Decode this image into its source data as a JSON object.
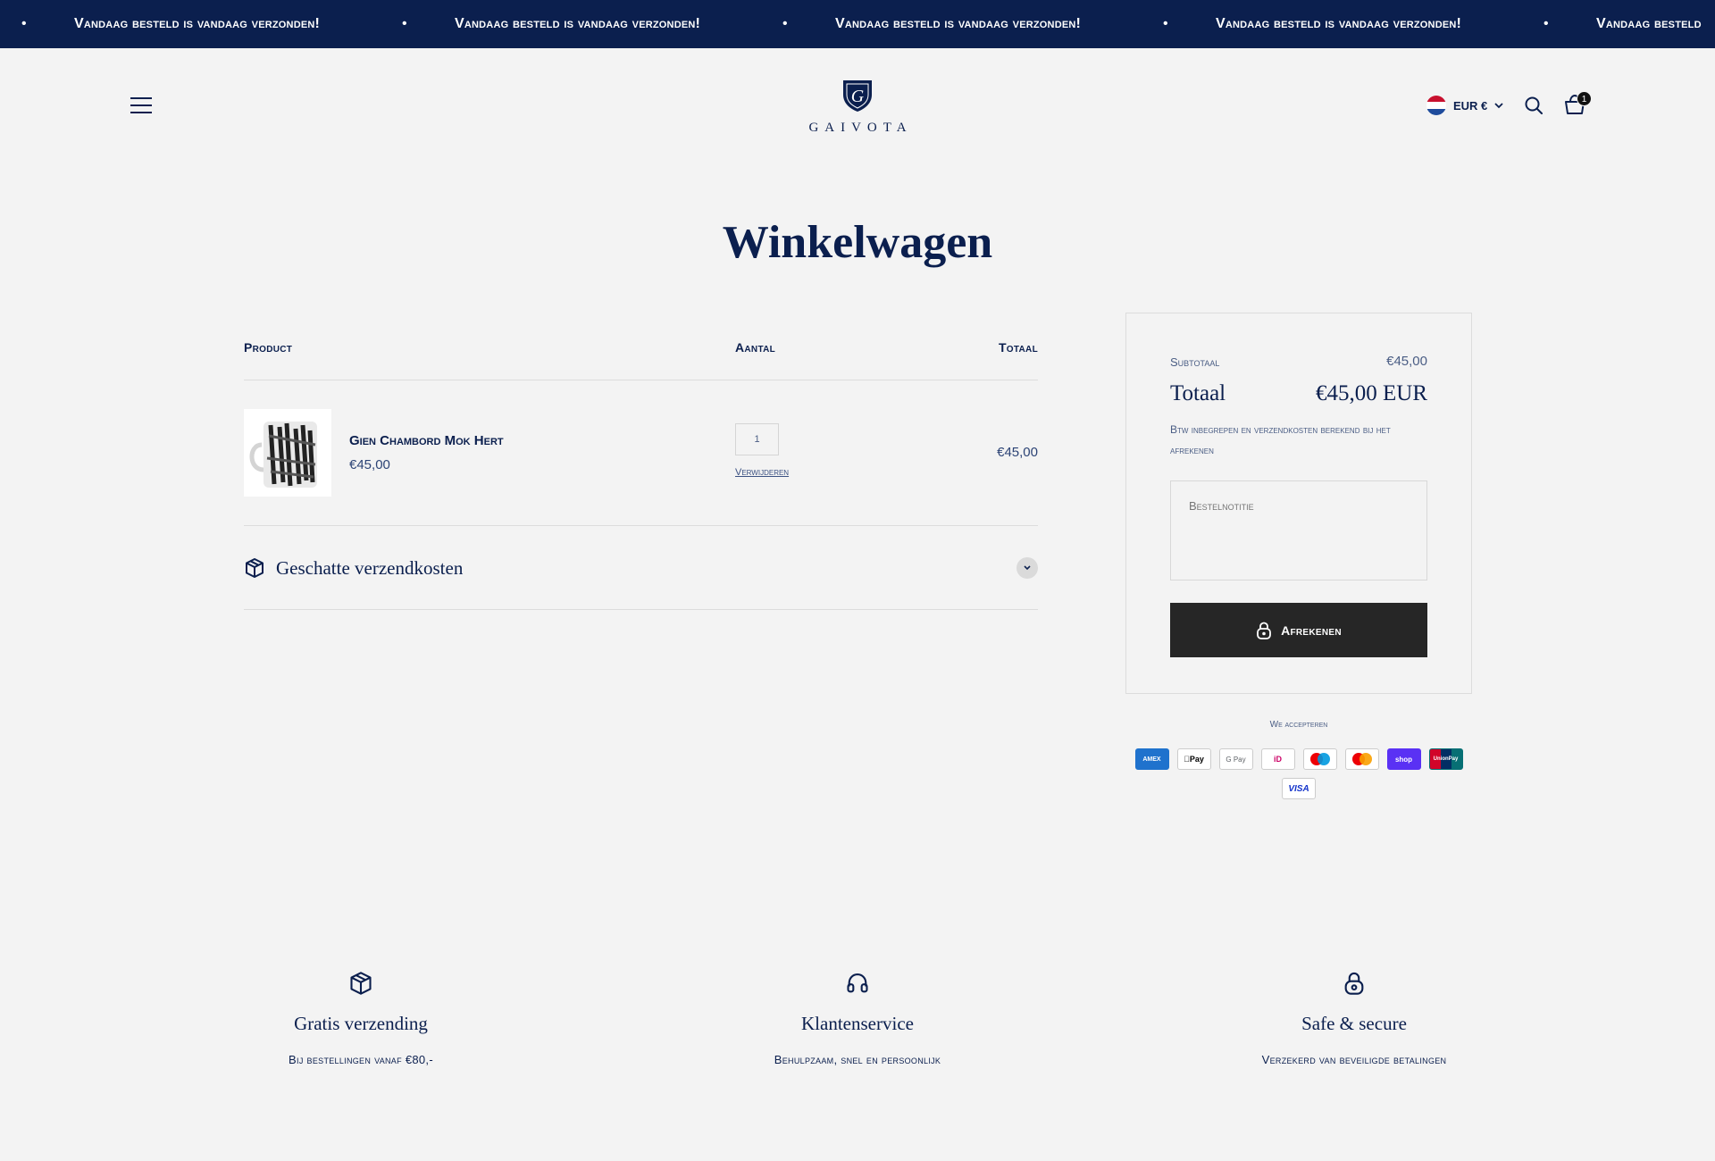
{
  "announcement": {
    "items": [
      "Vandaag besteld is vandaag verzonden!",
      "Vandaag besteld is vandaag verzonden!",
      "Vandaag besteld is vandaag verzonden!",
      "Vandaag besteld is vandaag verzonden!",
      "Vandaag besteld"
    ]
  },
  "header": {
    "logo_text": "GAIVOTA",
    "currency": "EUR €",
    "cart_count": "1"
  },
  "page_title": "Winkelwagen",
  "cart": {
    "columns": {
      "product": "Product",
      "quantity": "Aantal",
      "total": "Totaal"
    },
    "items": [
      {
        "name": "Gien Chambord Mok Hert",
        "price": "€45,00",
        "quantity": "1",
        "remove_label": "Verwijderen",
        "line_total": "€45,00"
      }
    ],
    "shipping_estimate_label": "Geschatte verzendkosten"
  },
  "summary": {
    "subtotal_label": "Subtotaal",
    "subtotal_value": "€45,00",
    "total_label": "Totaal",
    "total_value": "€45,00 EUR",
    "tax_note": "Btw inbegrepen en verzendkosten berekend bij het afrekenen",
    "order_note_placeholder": "Bestelnotitie",
    "checkout_label": "Afrekenen"
  },
  "payments": {
    "label": "We accepteren",
    "methods": [
      "American Express",
      "Apple Pay",
      "Google Pay",
      "iDEAL",
      "Maestro",
      "Mastercard",
      "Shop Pay",
      "UnionPay",
      "Visa"
    ]
  },
  "features": [
    {
      "icon": "box-icon",
      "title": "Gratis verzending",
      "text": "Bij bestellingen vanaf €80,-"
    },
    {
      "icon": "headphones-icon",
      "title": "Klantenservice",
      "text": "Behulpzaam, snel en persoonlijk"
    },
    {
      "icon": "lock-icon",
      "title": "Safe & secure",
      "text": "Verzekerd van beveiligde betalingen"
    }
  ],
  "colors": {
    "navy": "#0b1f4e",
    "background": "#f3f3f3",
    "checkout_button": "#262626"
  }
}
